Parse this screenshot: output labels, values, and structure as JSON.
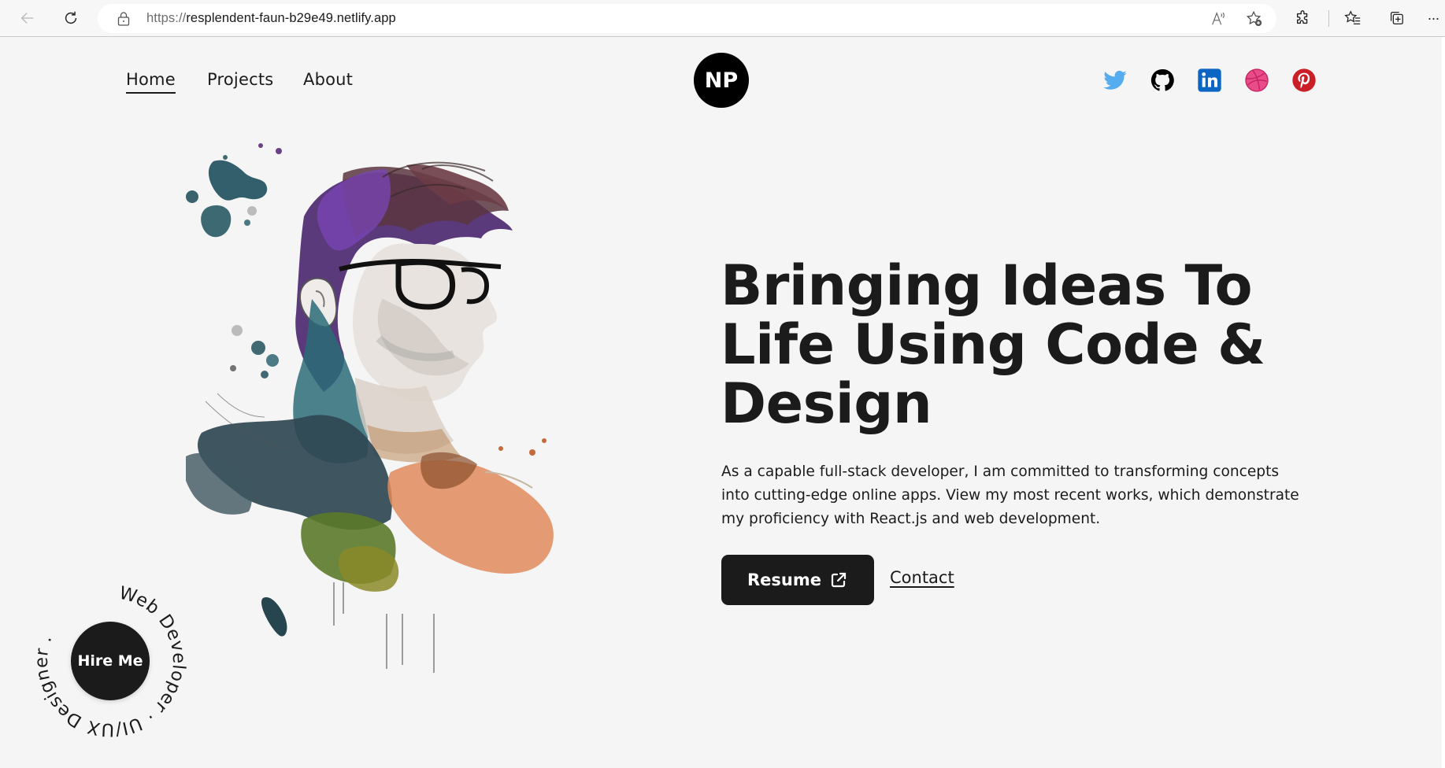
{
  "browser": {
    "url_protocol": "https://",
    "url_host": "resplendent-faun-b29e49.netlify.app",
    "icons": {
      "back": "back-arrow-icon",
      "refresh": "refresh-icon",
      "lock": "lock-icon",
      "read_aloud": "read-aloud-icon",
      "add_favorite": "add-favorite-icon",
      "extensions": "extensions-icon",
      "favorites": "favorites-icon",
      "collections": "collections-icon",
      "more": "more-icon"
    },
    "more_label": "···"
  },
  "nav": {
    "items": [
      {
        "label": "Home",
        "active": true
      },
      {
        "label": "Projects",
        "active": false
      },
      {
        "label": "About",
        "active": false
      }
    ]
  },
  "logo": {
    "text": "NP"
  },
  "social": [
    {
      "name": "twitter",
      "color": "#55acee"
    },
    {
      "name": "github",
      "color": "#000000"
    },
    {
      "name": "linkedin",
      "color": "#0a66c2"
    },
    {
      "name": "dribbble",
      "color": "#ea4c89"
    },
    {
      "name": "pinterest",
      "color": "#cb1f27"
    }
  ],
  "hero": {
    "headline": "Bringing Ideas To Life Using Code & Design",
    "intro": "As a capable full-stack developer, I am committed to transforming concepts into cutting-edge online apps. View my most recent works, which demonstrate my proficiency with React.js and web development.",
    "resume_label": "Resume",
    "contact_label": "Contact",
    "portrait_alt": "Watercolor portrait of a man with glasses"
  },
  "hire": {
    "label": "Hire Me",
    "ring_text": "Web Developer · UI/UX Designer ."
  },
  "colors": {
    "background": "#f5f5f5",
    "dark": "#1b1b1b"
  }
}
